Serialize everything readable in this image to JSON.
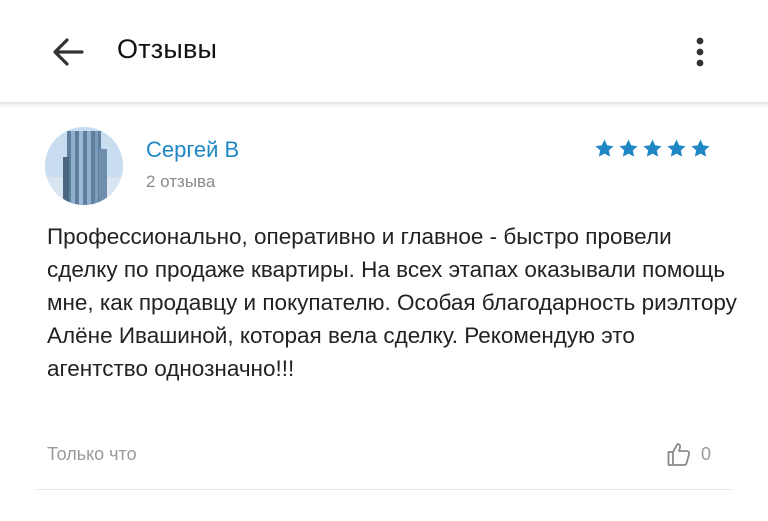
{
  "header": {
    "title": "Отзывы",
    "back_icon": "arrow-left-icon",
    "menu_icon": "more-vertical-icon"
  },
  "review": {
    "author": "Сергей В",
    "author_reviews": "2 отзыва",
    "rating": 5,
    "rating_max": 5,
    "text": "Профессионально, оперативно и главное - быстро провели сделку по продаже квартиры. На всех этапах оказывали помощь мне, как продавцу и покупателю. Особая благодарность риэлтору Алёне Ивашиной, которая вела сделку. Рекомендую это агентство однозначно!!!",
    "date": "Только что",
    "likes": "0",
    "like_icon": "thumbs-up-icon"
  },
  "colors": {
    "accent": "#1e88c7",
    "text": "#222222",
    "muted": "#9a9a9a"
  }
}
